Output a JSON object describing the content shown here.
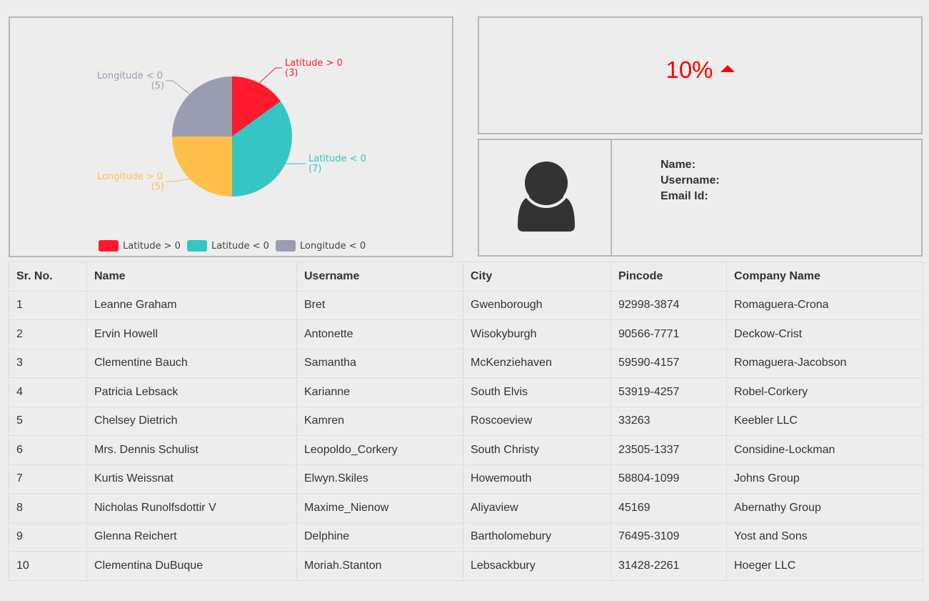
{
  "chart_data": {
    "type": "pie",
    "slices": [
      {
        "label": "Latitude > 0",
        "value": 3,
        "value_text": "(3)",
        "color": "#ff1a2e"
      },
      {
        "label": "Latitude < 0",
        "value": 7,
        "value_text": "(7)",
        "color": "#35c6c4"
      },
      {
        "label": "Longitude > 0",
        "value": 5,
        "value_text": "(5)",
        "color": "#ffbf48"
      },
      {
        "label": "Longitude < 0",
        "value": 5,
        "value_text": "(5)",
        "color": "#9a9cb2"
      }
    ],
    "legend": {
      "placement": "bottom",
      "items": [
        {
          "label": "Latitude > 0",
          "color": "#ff1a2e"
        },
        {
          "label": "Latitude < 0",
          "color": "#35c6c4"
        },
        {
          "label": "Longitude < 0",
          "color": "#9a9cb2"
        }
      ]
    }
  },
  "stat": {
    "value": "10%",
    "trend": "up",
    "trend_icon": "caret-up-icon",
    "color": "#ff0000"
  },
  "profile": {
    "avatar_icon": "user-icon",
    "name_label": "Name:",
    "username_label": "Username:",
    "email_label": "Email Id:"
  },
  "table": {
    "headers": [
      "Sr. No.",
      "Name",
      "Username",
      "City",
      "Pincode",
      "Company Name"
    ],
    "rows": [
      [
        "1",
        "Leanne Graham",
        "Bret",
        "Gwenborough",
        "92998-3874",
        "Romaguera-Crona"
      ],
      [
        "2",
        "Ervin Howell",
        "Antonette",
        "Wisokyburgh",
        "90566-7771",
        "Deckow-Crist"
      ],
      [
        "3",
        "Clementine Bauch",
        "Samantha",
        "McKenziehaven",
        "59590-4157",
        "Romaguera-Jacobson"
      ],
      [
        "4",
        "Patricia Lebsack",
        "Karianne",
        "South Elvis",
        "53919-4257",
        "Robel-Corkery"
      ],
      [
        "5",
        "Chelsey Dietrich",
        "Kamren",
        "Roscoeview",
        "33263",
        "Keebler LLC"
      ],
      [
        "6",
        "Mrs. Dennis Schulist",
        "Leopoldo_Corkery",
        "South Christy",
        "23505-1337",
        "Considine-Lockman"
      ],
      [
        "7",
        "Kurtis Weissnat",
        "Elwyn.Skiles",
        "Howemouth",
        "58804-1099",
        "Johns Group"
      ],
      [
        "8",
        "Nicholas Runolfsdottir V",
        "Maxime_Nienow",
        "Aliyaview",
        "45169",
        "Abernathy Group"
      ],
      [
        "9",
        "Glenna Reichert",
        "Delphine",
        "Bartholomebury",
        "76495-3109",
        "Yost and Sons"
      ],
      [
        "10",
        "Clementina DuBuque",
        "Moriah.Stanton",
        "Lebsackbury",
        "31428-2261",
        "Hoeger LLC"
      ]
    ]
  }
}
